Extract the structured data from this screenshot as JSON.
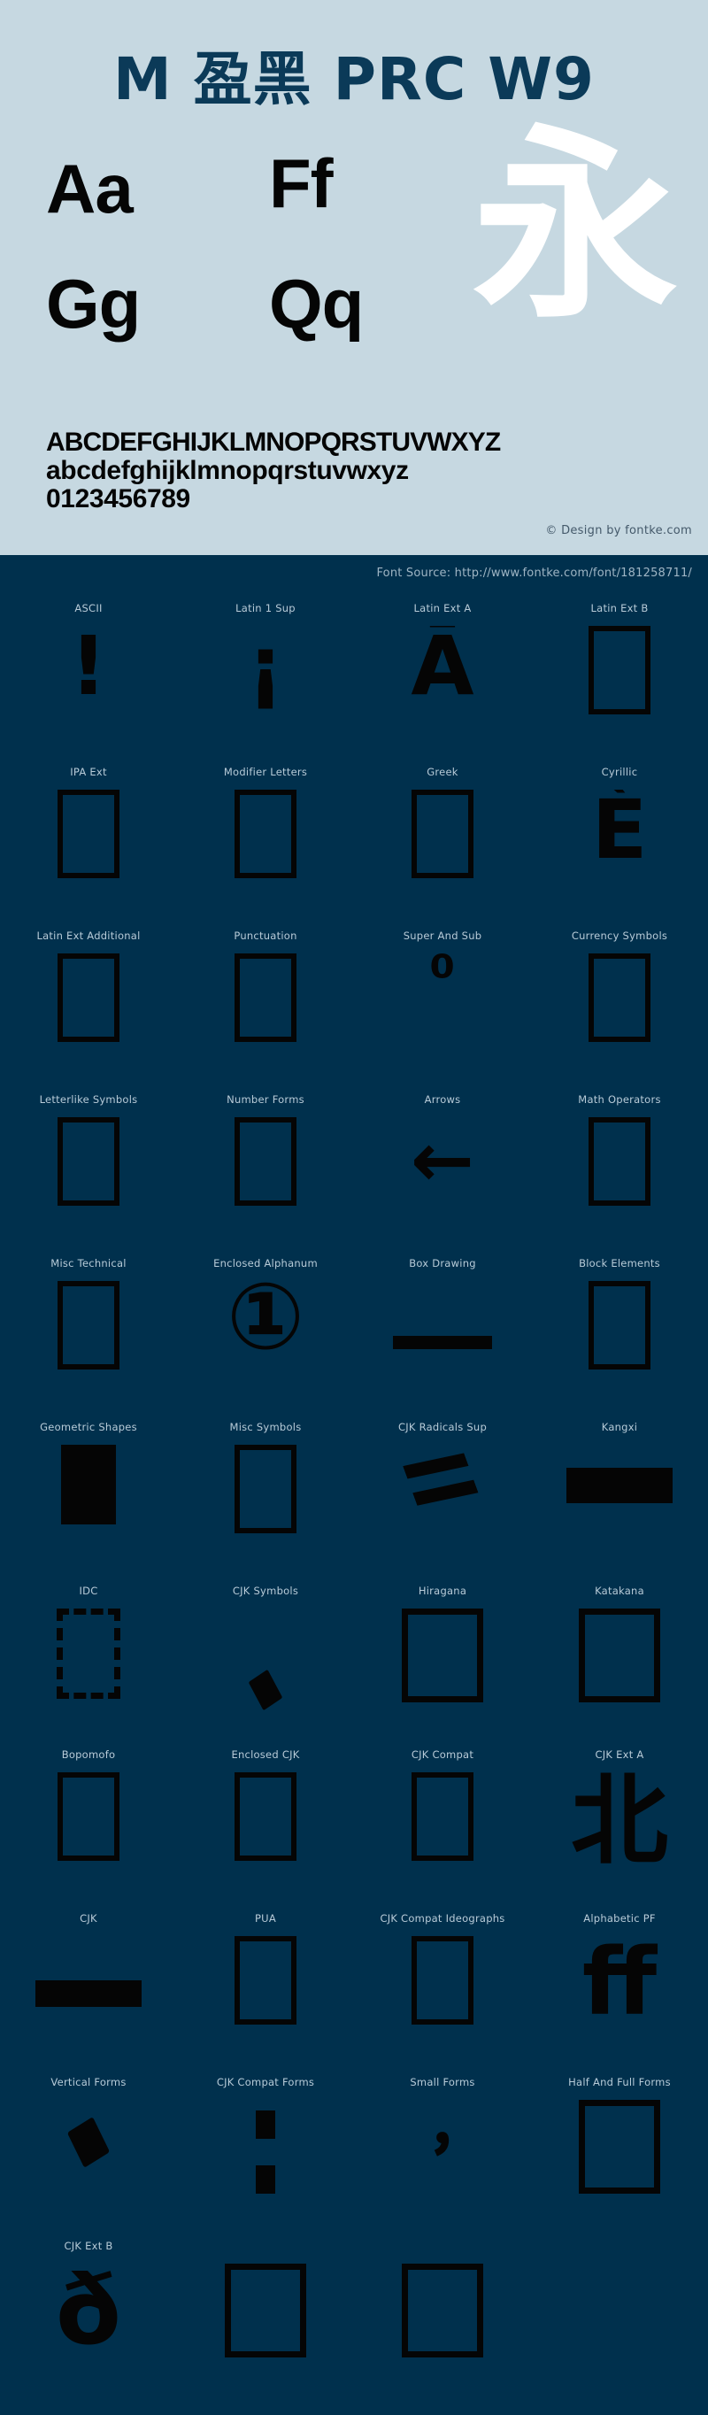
{
  "header": {
    "title": "M 盈黑 PRC W9",
    "specimens": [
      {
        "name": "Aa",
        "text": "Aa"
      },
      {
        "name": "Ff",
        "text": "Ff"
      },
      {
        "name": "Gg",
        "text": "Gg"
      },
      {
        "name": "Qq",
        "text": "Qq"
      }
    ],
    "cjk_sample": "永",
    "alphabet": {
      "uppercase": "ABCDEFGHIJKLMNOPQRSTUVWXYZ",
      "lowercase": "abcdefghijklmnopqrstuvwxyz",
      "digits": "0123456789"
    },
    "copyright": "© Design by fontke.com",
    "background_color": "#c6d8e1",
    "title_color": "#0b3a58",
    "cjk_color": "#ffffff"
  },
  "body": {
    "font_source": "Font Source: http://www.fontke.com/font/181258711/",
    "background_color": "#00304d",
    "label_color": "#b8cbd8",
    "glyph_color": "#050505",
    "blocks": [
      {
        "label": "ASCII",
        "glyph": "!",
        "style": "raw"
      },
      {
        "label": "Latin 1 Sup",
        "glyph": "¡",
        "style": "raw"
      },
      {
        "label": "Latin Ext A",
        "glyph": "Ā",
        "style": "raw"
      },
      {
        "label": "Latin Ext B",
        "glyph": "",
        "style": "tofu"
      },
      {
        "label": "IPA Ext",
        "glyph": "",
        "style": "tofu"
      },
      {
        "label": "Modifier Letters",
        "glyph": "",
        "style": "tofu"
      },
      {
        "label": "Greek",
        "glyph": "",
        "style": "tofu"
      },
      {
        "label": "Cyrillic",
        "glyph": "È",
        "style": "raw"
      },
      {
        "label": "Latin Ext Additional",
        "glyph": "",
        "style": "tofu"
      },
      {
        "label": "Punctuation",
        "glyph": "",
        "style": "tofu"
      },
      {
        "label": "Super And Sub",
        "glyph": "⁰",
        "style": "raw-sup"
      },
      {
        "label": "Currency Symbols",
        "glyph": "",
        "style": "tofu"
      },
      {
        "label": "Letterlike Symbols",
        "glyph": "",
        "style": "tofu"
      },
      {
        "label": "Number Forms",
        "glyph": "",
        "style": "tofu"
      },
      {
        "label": "Arrows",
        "glyph": "←",
        "style": "raw-arrow"
      },
      {
        "label": "Math Operators",
        "glyph": "",
        "style": "tofu"
      },
      {
        "label": "Misc Technical",
        "glyph": "",
        "style": "tofu"
      },
      {
        "label": "Enclosed Alphanum",
        "glyph": "①",
        "style": "raw-circ"
      },
      {
        "label": "Box Drawing",
        "glyph": "─",
        "style": "hline"
      },
      {
        "label": "Block Elements",
        "glyph": "",
        "style": "tofu"
      },
      {
        "label": "Geometric Shapes",
        "glyph": "█",
        "style": "solid-box"
      },
      {
        "label": "Misc Symbols",
        "glyph": "",
        "style": "tofu"
      },
      {
        "label": "CJK Radicals Sup",
        "glyph": "⺀",
        "style": "slash-pair"
      },
      {
        "label": "Kangxi",
        "glyph": "一",
        "style": "bar"
      },
      {
        "label": "IDC",
        "glyph": "⿰",
        "style": "tofu-dashed"
      },
      {
        "label": "CJK Symbols",
        "glyph": "、",
        "style": "diamond-sm"
      },
      {
        "label": "Hiragana",
        "glyph": "",
        "style": "tofu-wide"
      },
      {
        "label": "Katakana",
        "glyph": "",
        "style": "tofu-wide"
      },
      {
        "label": "Bopomofo",
        "glyph": "",
        "style": "tofu"
      },
      {
        "label": "Enclosed CJK",
        "glyph": "",
        "style": "tofu"
      },
      {
        "label": "CJK Compat",
        "glyph": "",
        "style": "tofu"
      },
      {
        "label": "CJK Ext A",
        "glyph": "北",
        "style": "raw-cjk"
      },
      {
        "label": "CJK",
        "glyph": "一",
        "style": "bar-short"
      },
      {
        "label": "PUA",
        "glyph": "",
        "style": "tofu"
      },
      {
        "label": "CJK Compat Ideographs",
        "glyph": "",
        "style": "tofu"
      },
      {
        "label": "Alphabetic PF",
        "glyph": "ﬀ",
        "style": "raw-lig"
      },
      {
        "label": "Vertical Forms",
        "glyph": "︐",
        "style": "diamond"
      },
      {
        "label": "CJK Compat Forms",
        "glyph": "：",
        "style": "twodots"
      },
      {
        "label": "Small Forms",
        "glyph": "﹐",
        "style": "raw-comma"
      },
      {
        "label": "Half And Full Forms",
        "glyph": "",
        "style": "tofu-wide"
      },
      {
        "label": "CJK Ext B",
        "glyph": "ð",
        "style": "raw-eth"
      },
      {
        "label": "",
        "glyph": "",
        "style": "tofu-wide"
      },
      {
        "label": "",
        "glyph": "",
        "style": "tofu-wide"
      },
      {
        "label": "",
        "glyph": "",
        "style": "empty"
      }
    ]
  }
}
